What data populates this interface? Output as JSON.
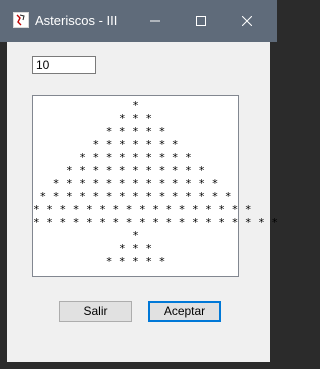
{
  "window": {
    "title": "Asteriscos - III"
  },
  "input": {
    "value": "10"
  },
  "output": {
    "lines": [
      "*",
      "* * *",
      "* * * * *",
      "* * * * * * *",
      "* * * * * * * * *",
      "* * * * * * * * * * *",
      "* * * * * * * * * * * * *",
      "* * * * * * * * * * * * * * *",
      "* * * * * * * * * * * * * * * * *",
      "* * * * * * * * * * * * * * * * * * *",
      "*",
      "* * *",
      "* * * * *"
    ]
  },
  "buttons": {
    "salir": "Salir",
    "aceptar": "Aceptar"
  },
  "icons": {
    "app": "app-icon",
    "minimize": "minimize-icon",
    "maximize": "maximize-icon",
    "close": "close-icon"
  },
  "colors": {
    "titlebar": "#5f6b7a",
    "focus": "#0078d7",
    "client": "#f0f0f0"
  }
}
